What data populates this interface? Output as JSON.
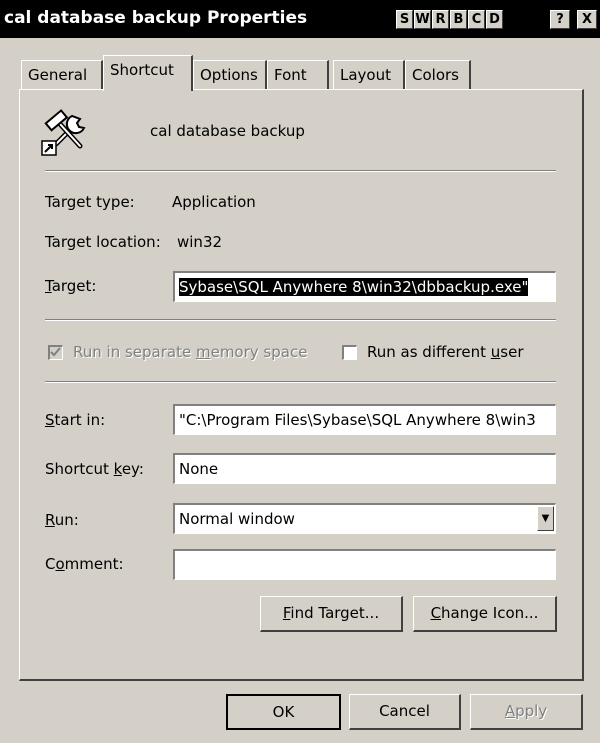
{
  "window": {
    "title": "cal database backup Properties",
    "title_buttons": [
      "S",
      "W",
      "R",
      "B",
      "C",
      "D",
      "?",
      "X"
    ]
  },
  "tabs": [
    {
      "label": "General"
    },
    {
      "label": "Shortcut"
    },
    {
      "label": "Options"
    },
    {
      "label": "Font"
    },
    {
      "label": "Layout"
    },
    {
      "label": "Colors"
    }
  ],
  "header": {
    "icon": "hammer-wrench-shortcut-icon",
    "name": "cal database backup"
  },
  "info": {
    "target_type_label": "Target type:",
    "target_type_value": "Application",
    "target_location_label": "Target location:",
    "target_location_value": "win32"
  },
  "target": {
    "label_mnemonic": "T",
    "label_rest": "arget:",
    "value": "Sybase\\SQL Anywhere 8\\win32\\dbbackup.exe\""
  },
  "options": {
    "separate_memory": {
      "label_pre": "Run in separate ",
      "label_mnemonic": "m",
      "label_post": "emory space",
      "checked": true,
      "disabled": true
    },
    "different_user": {
      "label_pre": "Run as different ",
      "label_mnemonic": "u",
      "label_post": "ser",
      "checked": false
    }
  },
  "start_in": {
    "label_mnemonic": "S",
    "label_rest": "tart in:",
    "value": "\"C:\\Program Files\\Sybase\\SQL Anywhere 8\\win3"
  },
  "shortcut_key": {
    "label_pre": "Shortcut ",
    "label_mnemonic": "k",
    "label_post": "ey:",
    "value": "None"
  },
  "run": {
    "label_mnemonic": "R",
    "label_rest": "un:",
    "value": "Normal window"
  },
  "comment": {
    "label_pre": "C",
    "label_mnemonic": "o",
    "label_post": "mment:",
    "value": ""
  },
  "actions": {
    "find_target_mnemonic": "F",
    "find_target_rest": "ind Target...",
    "change_icon_mnemonic": "C",
    "change_icon_rest": "hange Icon..."
  },
  "footer": {
    "ok": "OK",
    "cancel": "Cancel",
    "apply_mnemonic": "A",
    "apply_rest": "pply"
  }
}
